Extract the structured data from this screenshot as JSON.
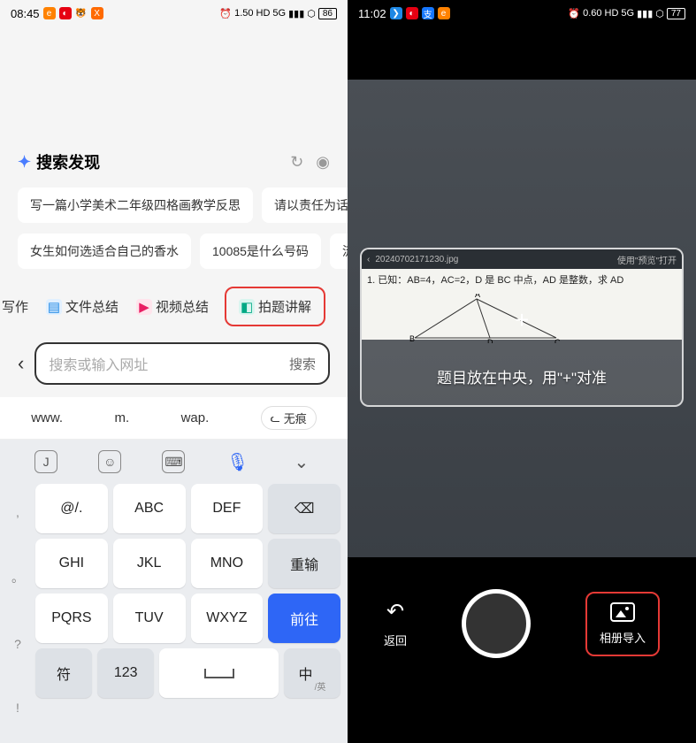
{
  "left": {
    "status": {
      "time": "08:45",
      "speed": "1.50",
      "speed_unit": "KB/s",
      "net1": "HD",
      "net2": "5G",
      "battery": "86"
    },
    "discover": {
      "title": "搜索发现",
      "chips_row1": [
        "写一篇小学美术二年级四格画教学反思",
        "请以责任为话题写"
      ],
      "chips_row2": [
        "女生如何选适合自己的香水",
        "10085是什么号码",
        "流量"
      ]
    },
    "tabs": {
      "write": "写作",
      "file_summary": "文件总结",
      "video_summary": "视频总结",
      "photo_solve": "拍题讲解"
    },
    "search": {
      "placeholder": "搜索或输入网址",
      "button": "搜索"
    },
    "quick": {
      "www": "www.",
      "m": "m.",
      "wap": "wap.",
      "incognito": "无痕"
    },
    "keyboard": {
      "side": [
        ",",
        "。",
        "?",
        "!"
      ],
      "r1": [
        "@/.",
        "ABC",
        "DEF"
      ],
      "r1_fn": "⌫",
      "r2": [
        "GHI",
        "JKL",
        "MNO"
      ],
      "r2_fn": "重输",
      "r3": [
        "PQRS",
        "TUV",
        "WXYZ"
      ],
      "r3_fn": "前往",
      "r4_sym": "符",
      "r4_num": "123",
      "r4_lang": "中",
      "r4_lang_sub": "/英"
    }
  },
  "right": {
    "status": {
      "time": "11:02",
      "speed": "0.60",
      "speed_unit": "KB/s",
      "net1": "HD",
      "net2": "5G",
      "battery": "77"
    },
    "doc": {
      "filename": "20240702171230.jpg",
      "hint_right": "使用\"预览\"打开",
      "problem": "1. 已知：AB=4，AC=2，D 是 BC 中点，AD 是整数，求 AD",
      "labels": {
        "A": "A",
        "B": "B",
        "C": "C",
        "D": "D"
      }
    },
    "overlay": "题目放在中央，用\"+\"对准",
    "controls": {
      "back": "返回",
      "gallery": "相册导入"
    }
  }
}
